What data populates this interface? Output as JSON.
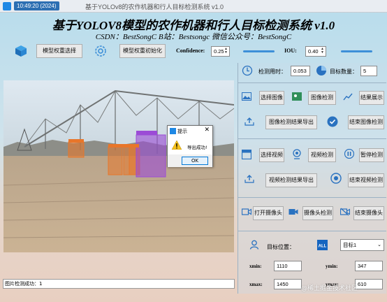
{
  "window": {
    "time_badge": "10:49:20 (2024)",
    "title_tail": "基于YOLOv8的农作机器和行人目标检测系统 v1.0"
  },
  "header": {
    "title": "基于YOLOV8模型的农作机器和行人目标检测系统 v1.0",
    "subtitle": "CSDN：BestSongC   B站：Bestsongc   微信公众号：BestSongC"
  },
  "model_bar": {
    "select_weights_label": "模型权重选择",
    "init_weights_label": "模型权重初始化",
    "confidence_label": "Confidence:",
    "confidence_value": "0.25",
    "confidence_slider": 0.25,
    "iou_label": "IOU:",
    "iou_value": "0.40",
    "iou_slider": 0.4
  },
  "stats": {
    "time_label": "检测用时：",
    "time_value": "0.053",
    "count_label": "目标数量：",
    "count_value": "5"
  },
  "image_section": {
    "select_image": "选择图像",
    "detect_image": "图像检测",
    "show_results": "结果展示",
    "export_results": "图像检测结果导出",
    "end_detection": "结束图像检测"
  },
  "video_section": {
    "select_video": "选择视频",
    "detect_video": "视频检测",
    "pause_detection": "暂停检测",
    "export_results": "视频检测结果导出",
    "end_detection": "结束视频检测"
  },
  "camera_section": {
    "open_camera": "打开摄像头",
    "camera_detect": "摄像头检测",
    "close_camera": "结束摄像头"
  },
  "target": {
    "position_label": "目标位置：",
    "select_value": "目标1",
    "xmin_label": "xmin:",
    "xmin_value": "1110",
    "ymin_label": "ymin:",
    "ymin_value": "347",
    "xmax_label": "xmax:",
    "xmax_value": "1450",
    "ymax_label": "ymax:",
    "ymax_value": "610"
  },
  "status": {
    "text": "图片检测成功：1"
  },
  "dialog": {
    "title": "提示",
    "message": "导出成功!",
    "ok_label": "OK"
  },
  "watermark": "@稀土掘金技术社区",
  "colors": {
    "accent": "#3d8fd8",
    "detection_orange": "#e8762a",
    "detection_purple": "#9b4bd6"
  }
}
